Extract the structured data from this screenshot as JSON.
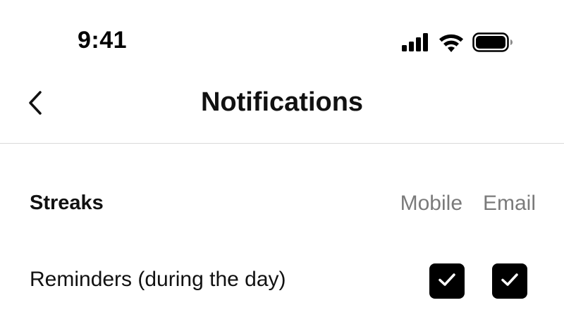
{
  "status_bar": {
    "time": "9:41"
  },
  "nav": {
    "title": "Notifications",
    "back_icon": "chevron-left-icon"
  },
  "section": {
    "title": "Streaks",
    "columns": {
      "mobile": "Mobile",
      "email": "Email"
    }
  },
  "rows": [
    {
      "label": "Reminders (during the day)",
      "mobile_checked": true,
      "email_checked": true
    }
  ],
  "colors": {
    "text": "#111111",
    "muted": "#7a7a7a",
    "checkbox": "#000000",
    "divider": "#d9d9d9"
  }
}
